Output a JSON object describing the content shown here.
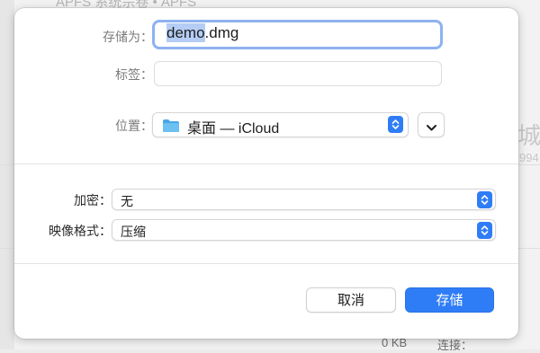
{
  "background_window": {
    "title": "APFS 系统宗卷 • APFS",
    "right_glyph": "城",
    "right_digits": "994",
    "bottom_size": "0 KB",
    "bottom_connect": "连接："
  },
  "save_dialog": {
    "save_as_label": "存储为：",
    "filename_base": "demo",
    "filename_ext": ".dmg",
    "tags_label": "标签：",
    "tags_value": "",
    "location_label": "位置：",
    "location_value": "桌面 — iCloud",
    "encryption_label": "加密：",
    "encryption_value": "无",
    "image_format_label": "映像格式：",
    "image_format_value": "压缩",
    "cancel_label": "取消",
    "save_label": "存储"
  },
  "colors": {
    "accent": "#2f7df6",
    "focus_ring": "#8eb2f0",
    "selection": "#b5cdf4",
    "folder_icon": "#4aa7e6"
  },
  "icons": {
    "location_folder": "folder-icon",
    "expand": "chevron-down-icon",
    "popup": "updown-chevron-icon"
  }
}
